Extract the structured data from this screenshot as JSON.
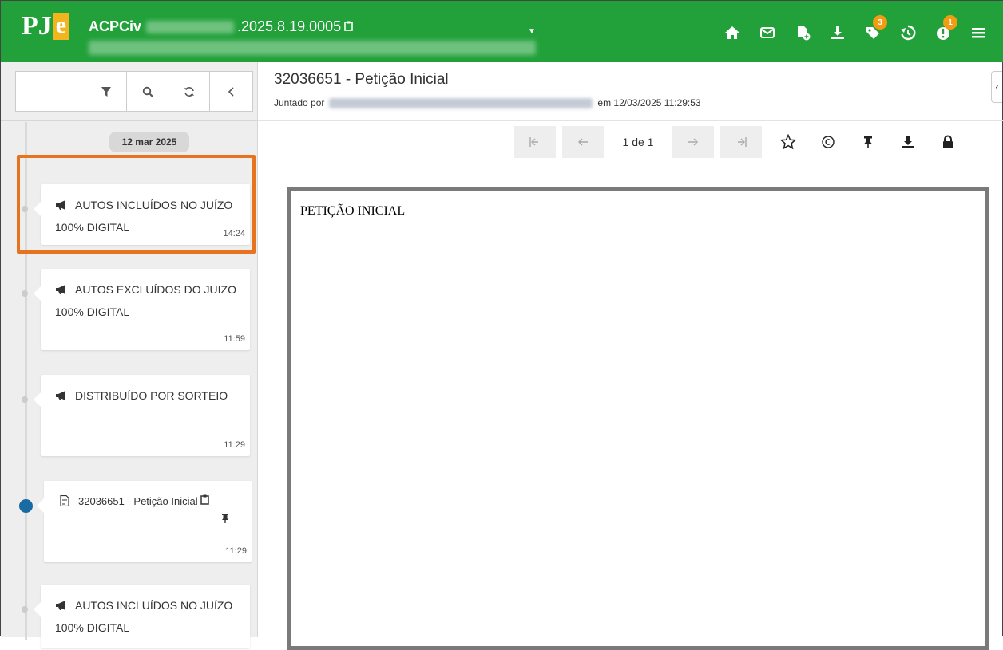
{
  "header": {
    "logo_text": "PJ",
    "logo_accent": "e",
    "process_class": "ACPCiv",
    "process_number_suffix": ".2025.8.19.0005",
    "icons": [
      {
        "name": "home-icon"
      },
      {
        "name": "mail-icon"
      },
      {
        "name": "new-document-icon"
      },
      {
        "name": "download-icon"
      },
      {
        "name": "tag-icon",
        "badge": "3"
      },
      {
        "name": "history-icon"
      },
      {
        "name": "alert-icon",
        "badge": "1"
      },
      {
        "name": "menu-icon"
      }
    ],
    "bg_color": "#22a13a",
    "badge_color": "#f39c12"
  },
  "sidebar": {
    "date_label": "12 mar 2025",
    "items": [
      {
        "type": "movement",
        "text": "AUTOS INCLUÍDOS NO JUÍZO 100% DIGITAL",
        "time": "14:24",
        "highlighted": true
      },
      {
        "type": "movement",
        "text": "AUTOS EXCLUÍDOS DO JUIZO 100% DIGITAL",
        "time": "11:59"
      },
      {
        "type": "movement",
        "text": "DISTRIBUÍDO POR SORTEIO",
        "time": "11:29"
      },
      {
        "type": "document",
        "text": "32036651 - Petição Inicial",
        "time": "11:29",
        "active": true
      },
      {
        "type": "movement",
        "text": "AUTOS INCLUÍDOS NO JUÍZO 100% DIGITAL",
        "time": ""
      }
    ],
    "highlight_color": "#e8731e",
    "active_dot_color": "#1a6aa4"
  },
  "document": {
    "title": "32036651 - Petição Inicial",
    "joined_by_label": "Juntado por",
    "joined_at": "em 12/03/2025 11:29:53",
    "page_indicator": "1 de 1",
    "content_heading": "PETIÇÃO INICIAL"
  }
}
